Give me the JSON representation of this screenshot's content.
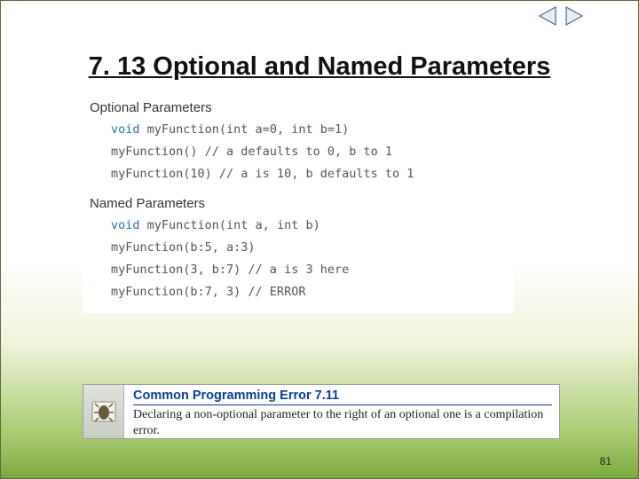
{
  "nav": {
    "prev": "prev",
    "next": "next"
  },
  "title": "7. 13 Optional and Named Parameters",
  "optional": {
    "label": "Optional Parameters",
    "sig_kw": "void",
    "sig_rest": " myFunction(int a=0, int b=1)",
    "line2": "myFunction() // a defaults to 0, b to 1",
    "line3": "myFunction(10) // a is 10, b defaults to 1"
  },
  "named": {
    "label": "Named Parameters",
    "sig_kw": "void",
    "sig_rest": " myFunction(int a, int b)",
    "line2": "myFunction(b:5, a:3)",
    "line3": "myFunction(3, b:7) // a is 3 here",
    "line4": "myFunction(b:7, 3) // ERROR"
  },
  "error": {
    "title": "Common Programming Error 7.11",
    "body": "Declaring a non-optional parameter to the right of an optional one is a compilation error."
  },
  "pagenum": "81"
}
